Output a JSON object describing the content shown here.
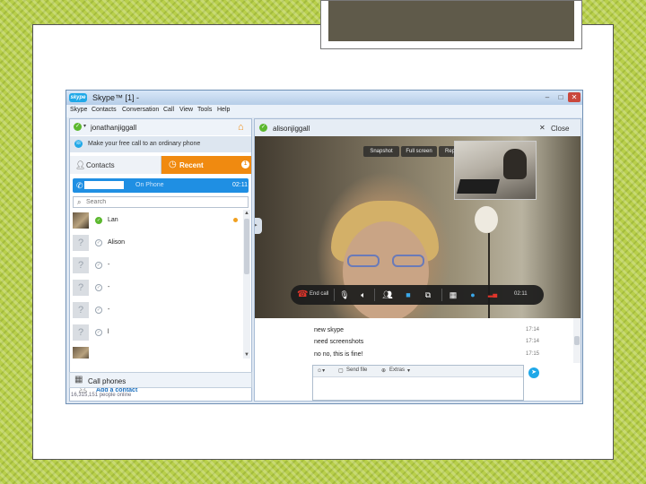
{
  "window": {
    "logo": "skype",
    "title": "Skype™ [1] -",
    "controls": {
      "minimize": "–",
      "maximize": "□",
      "close": "✕"
    }
  },
  "menu": [
    "Skype",
    "Contacts",
    "Conversation",
    "Call",
    "View",
    "Tools",
    "Help"
  ],
  "profile": {
    "name": "jonathanjiggall",
    "caret": "▾",
    "status_icon": "skype-online-icon",
    "home_icon": "home-icon"
  },
  "promo": {
    "text": "Make your free call to an ordinary phone"
  },
  "tabs": {
    "contacts": "Contacts",
    "recent": "Recent",
    "recent_badge": "1"
  },
  "active_call": {
    "status": "On Phone",
    "time": "02:11"
  },
  "search": {
    "placeholder": "Search"
  },
  "contacts": [
    {
      "name": "Lan",
      "online": true,
      "photo": true,
      "indicator": true
    },
    {
      "name": "Alison",
      "online": false
    },
    {
      "name": "-",
      "online": false
    },
    {
      "name": "-",
      "online": false
    },
    {
      "name": "-",
      "online": false
    },
    {
      "name": "l",
      "online": false
    },
    {
      "name": "",
      "online": false,
      "photo": true
    }
  ],
  "add_contact": "Add a contact",
  "call_phones": "Call phones",
  "online_count": "16,315,151 people online",
  "chat": {
    "contact": "alisonjiggall",
    "close": "Close"
  },
  "video_buttons": {
    "snapshot": "Snapshot",
    "fullscreen": "Full screen",
    "report": "Report"
  },
  "call_controls": {
    "end_call": "End call",
    "timer": "02:11"
  },
  "messages": [
    {
      "text": "",
      "time": ""
    },
    {
      "text": "new skype",
      "time": "17:14"
    },
    {
      "text": "need screenshots",
      "time": "17:14"
    },
    {
      "text": "no no, this is fine!",
      "time": "17:15"
    }
  ],
  "composer": {
    "send_file": "Send file",
    "extras": "Extras"
  },
  "colors": {
    "accent": "#f08a10",
    "skype_blue": "#1fa8e8",
    "call_bar": "#1f8fe3",
    "online_green": "#5cb82f",
    "end_call_red": "#e0352b",
    "slide_bg": "#b8cf4a"
  }
}
